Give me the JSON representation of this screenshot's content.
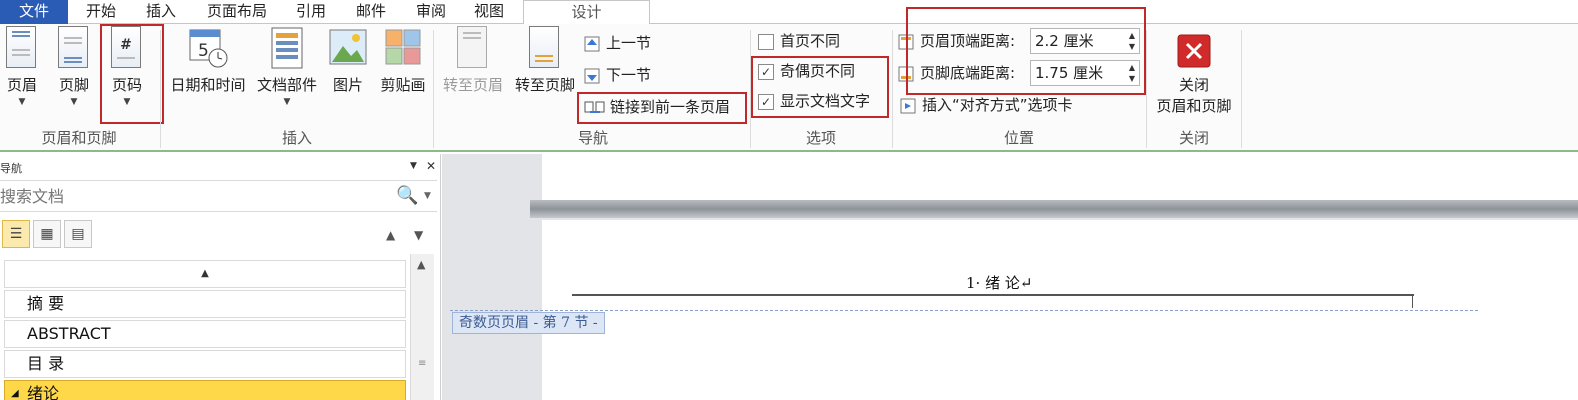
{
  "tabs": [
    "文件",
    "开始",
    "插入",
    "页面布局",
    "引用",
    "邮件",
    "审阅",
    "视图",
    "设计"
  ],
  "ribbon": {
    "groups": {
      "header_footer": "页眉和页脚",
      "insert": "插入",
      "navigation": "导航",
      "options": "选项",
      "position": "位置",
      "close": "关闭"
    },
    "header": "页眉",
    "footer": "页脚",
    "page_number": "页码",
    "date_time": "日期和时间",
    "doc_parts": "文档部件",
    "picture": "图片",
    "clipart": "剪贴画",
    "goto_header": "转至页眉",
    "goto_footer": "转至页脚",
    "prev_section": "上一节",
    "next_section": "下一节",
    "link_previous": "链接到前一条页眉",
    "different_first": "首页不同",
    "different_odd_even": "奇偶页不同",
    "show_doc_text": "显示文档文字",
    "header_from_top_label": "页眉顶端距离:",
    "header_from_top_value": "2.2 厘米",
    "footer_from_bottom_label": "页脚底端距离:",
    "footer_from_bottom_value": "1.75 厘米",
    "insert_align_tab": "插入“对齐方式”选项卡",
    "close_line1": "关闭",
    "close_line2": "页眉和页脚",
    "checks": {
      "different_first": false,
      "different_odd_even": true,
      "show_doc_text": true
    }
  },
  "nav_pane": {
    "title": "导航",
    "search_placeholder": "搜索文档",
    "headings": [
      "摘 要",
      "ABSTRACT",
      "目 录",
      "绪论"
    ],
    "top_marker": "▲"
  },
  "document": {
    "header_text": "1· 绪 论↵",
    "header_tag": "奇数页页眉 - 第 7 节 -"
  },
  "colors": {
    "file_tab": "#2a5bb5",
    "highlight_box": "#c0282a",
    "selected_heading": "#ffd84a",
    "close_icon": "#d02a2a"
  }
}
